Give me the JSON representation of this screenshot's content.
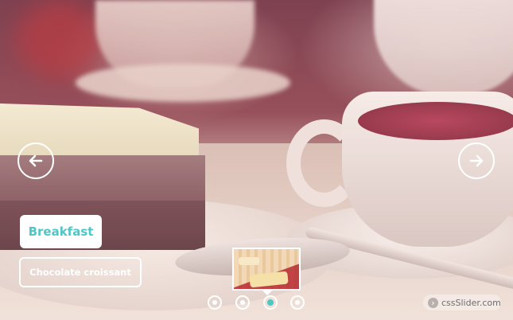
{
  "slide": {
    "title": "Breakfast",
    "caption": "Chocolate croissant"
  },
  "navigation": {
    "prev_icon": "arrow-left-icon",
    "next_icon": "arrow-right-icon",
    "dot_count": 4,
    "active_dot": 3
  },
  "watermark": {
    "text": "cssSlider.com"
  },
  "colors": {
    "accent": "#4fc7c4",
    "control": "#ffffff"
  }
}
